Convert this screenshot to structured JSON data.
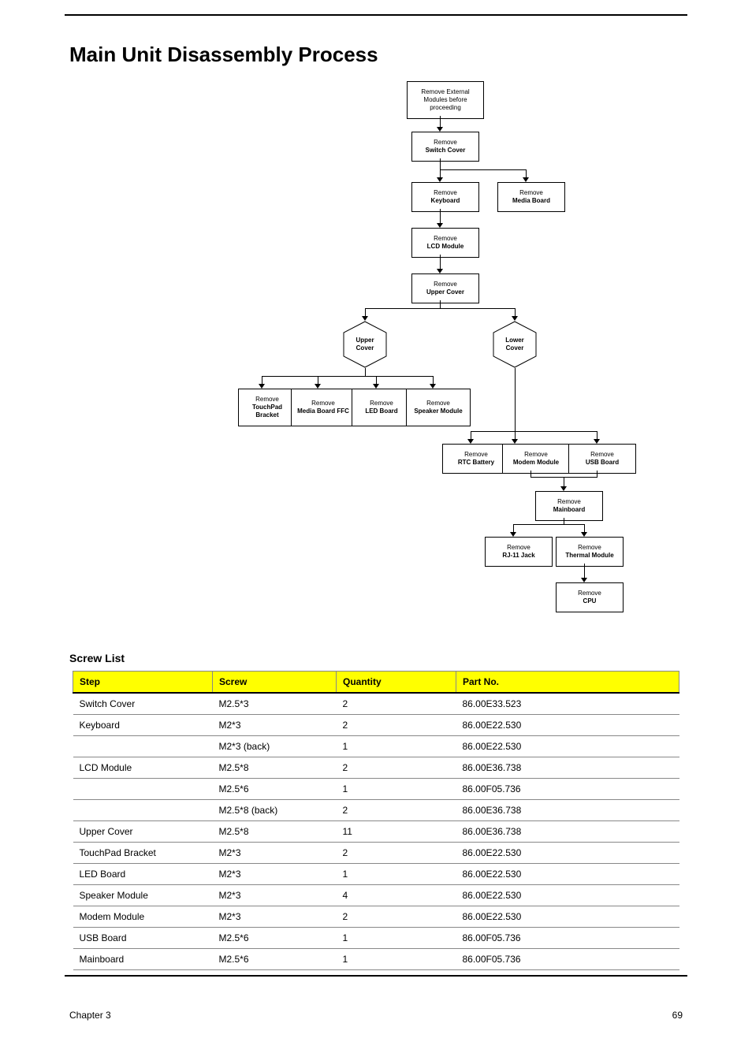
{
  "section_title": "Main Unit Disassembly Process",
  "flow": {
    "start": "Remove External\nModules before\nproceeding",
    "switch_cover": {
      "line1": "Remove",
      "line2": "Switch Cover"
    },
    "keyboard": {
      "line1": "Remove",
      "line2": "Keyboard"
    },
    "media_board": {
      "line1": "Remove",
      "line2": "Media Board"
    },
    "lcd_module": {
      "line1": "Remove",
      "line2": "LCD Module"
    },
    "upper_cover": {
      "line1": "Remove",
      "line2": "Upper Cover"
    },
    "hex_upper": "Upper\nCover",
    "hex_lower": "Lower\nCover",
    "touchpad_bracket": {
      "line1": "Remove",
      "line2l1": "TouchPad",
      "line2l2": "Bracket"
    },
    "media_board_ffc": {
      "line1": "Remove",
      "line2": "Media Board FFC"
    },
    "led_board": {
      "line1": "Remove",
      "line2": "LED Board"
    },
    "speaker_module": {
      "line1": "Remove",
      "line2": "Speaker Module"
    },
    "rtc_battery": {
      "line1": "Remove",
      "line2": "RTC Battery"
    },
    "modem_module": {
      "line1": "Remove",
      "line2": "Modem Module"
    },
    "usb_board": {
      "line1": "Remove",
      "line2": "USB Board"
    },
    "mainboard": {
      "line1": "Remove",
      "line2": "Mainboard"
    },
    "rj11_jack": {
      "line1": "Remove",
      "line2": "RJ-11 Jack"
    },
    "thermal_module": {
      "line1": "Remove",
      "line2": "Thermal Module"
    },
    "cpu": {
      "line1": "Remove",
      "line2": "CPU"
    }
  },
  "table": {
    "caption": "Screw List",
    "headers": [
      "Step",
      "Screw",
      "Quantity",
      "Part No."
    ],
    "rows": [
      [
        "Switch Cover",
        "M2.5*3",
        "2",
        "86.00E33.523"
      ],
      [
        "Keyboard",
        "M2*3",
        "2",
        "86.00E22.530"
      ],
      [
        "",
        "M2*3 (back)",
        "1",
        "86.00E22.530"
      ],
      [
        "LCD Module",
        "M2.5*8",
        "2",
        "86.00E36.738"
      ],
      [
        "",
        "M2.5*6",
        "1",
        "86.00F05.736"
      ],
      [
        "",
        "M2.5*8 (back)",
        "2",
        "86.00E36.738"
      ],
      [
        "Upper Cover",
        "M2.5*8",
        "11",
        "86.00E36.738"
      ],
      [
        "TouchPad Bracket",
        "M2*3",
        "2",
        "86.00E22.530"
      ],
      [
        "LED Board",
        "M2*3",
        "1",
        "86.00E22.530"
      ],
      [
        "Speaker Module",
        "M2*3",
        "4",
        "86.00E22.530"
      ],
      [
        "Modem Module",
        "M2*3",
        "2",
        "86.00E22.530"
      ],
      [
        "USB Board",
        "M2.5*6",
        "1",
        "86.00F05.736"
      ],
      [
        "Mainboard",
        "M2.5*6",
        "1",
        "86.00F05.736"
      ]
    ]
  },
  "footer": {
    "left": "Chapter 3",
    "right": "69"
  }
}
